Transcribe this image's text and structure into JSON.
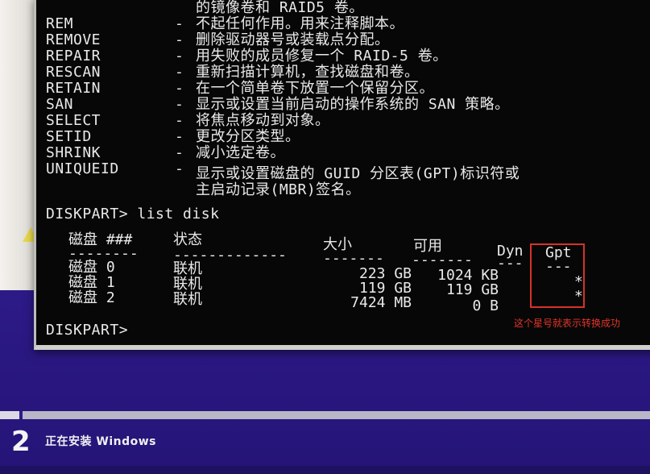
{
  "console": {
    "top_fragment": "的镜像卷和 RAID5 卷。",
    "commands": [
      {
        "name": "REM",
        "dash": "-",
        "desc": "不起任何作用。用来注释脚本。"
      },
      {
        "name": "REMOVE",
        "dash": "-",
        "desc": "删除驱动器号或装载点分配。"
      },
      {
        "name": "REPAIR",
        "dash": "-",
        "desc": "用失败的成员修复一个 RAID-5 卷。"
      },
      {
        "name": "RESCAN",
        "dash": "-",
        "desc": "重新扫描计算机，查找磁盘和卷。"
      },
      {
        "name": "RETAIN",
        "dash": "-",
        "desc": "在一个简单卷下放置一个保留分区。"
      },
      {
        "name": "SAN",
        "dash": "-",
        "desc": "显示或设置当前启动的操作系统的 SAN 策略。"
      },
      {
        "name": "SELECT",
        "dash": "-",
        "desc": "将焦点移动到对象。"
      },
      {
        "name": "SETID",
        "dash": "-",
        "desc": "更改分区类型。"
      },
      {
        "name": "SHRINK",
        "dash": "-",
        "desc": "减小选定卷。"
      },
      {
        "name": "UNIQUEID",
        "dash": "-",
        "desc": "显示或设置磁盘的 GUID 分区表(GPT)标识符或"
      }
    ],
    "uniqueid_desc_line2": "主启动记录(MBR)签名。",
    "prompt_command": "DISKPART> list disk",
    "table": {
      "headers": {
        "disk": "磁盘 ###",
        "status": "状态",
        "size": "大小",
        "free": "可用",
        "dyn": "Dyn",
        "gpt": "Gpt"
      },
      "underlines": {
        "disk": "--------",
        "status": "-------------",
        "size": "-------",
        "free": "-------",
        "dyn": "---",
        "gpt": "---"
      },
      "rows": [
        {
          "disk": "磁盘 0",
          "status": "联机",
          "size": "223 GB",
          "free": "1024 KB",
          "dyn": "",
          "gpt": ""
        },
        {
          "disk": "磁盘 1",
          "status": "联机",
          "size": "119 GB",
          "free": "119 GB",
          "dyn": "",
          "gpt": "*"
        },
        {
          "disk": "磁盘 2",
          "status": "联机",
          "size": "7424 MB",
          "free": "0 B",
          "dyn": "",
          "gpt": "*"
        }
      ]
    },
    "final_prompt": "DISKPART>"
  },
  "annotation": {
    "text": "这个星号就表示转换成功",
    "color": "#e0352b"
  },
  "setup": {
    "step_number": "2",
    "step_label": "正在安装 Windows"
  },
  "colors": {
    "console_bg": "#070707",
    "console_text": "#e9e9e9",
    "setup_bg": "#2e1a86",
    "annotation_red": "#d6322a"
  }
}
